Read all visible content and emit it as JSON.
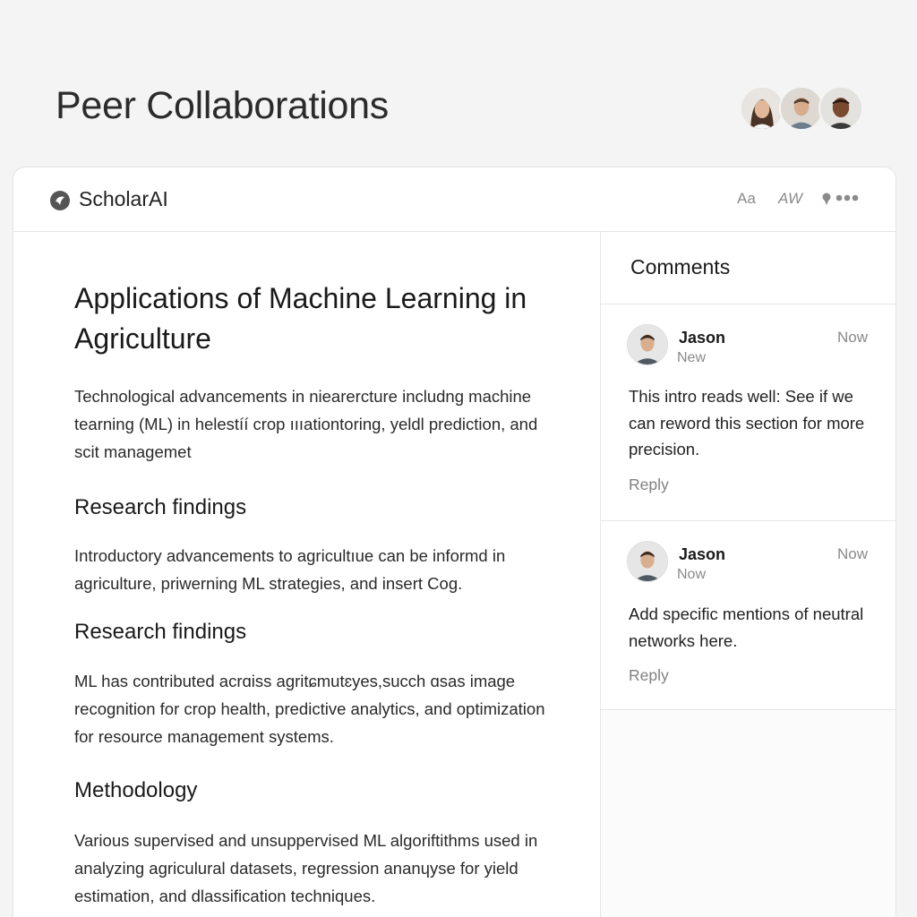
{
  "page": {
    "title": "Peer Collaborations"
  },
  "app": {
    "name": "ScholarAI",
    "tools": {
      "font": "Aa",
      "words": "AW",
      "more": "•••"
    }
  },
  "document": {
    "title": "Applications of Machine Learning in Agriculture",
    "intro": "Technological advancements in niearercture includng machine tearning (ML) in helestíí crop ıııationtoring, yeldl prediction, and scit managemet",
    "sections": [
      {
        "heading": "Research findings",
        "body": "Introductory advancements to agricultıue can be informd in agriculture, priwerning ML strategies, and insert Cog."
      },
      {
        "heading": "Research findings",
        "body": "ML has contributed acrɑiss agritɕmutɛyes,succh ɑsas image recognition for crop health, predictive analytics, and optimization for resource management systems."
      },
      {
        "heading": "Methodology",
        "body": "Various supervised and unsuppervised ML algoriftithms used in analyzing agriculural datasets, regression ananɥyse for yield estimation, and dlassification techniques."
      }
    ]
  },
  "comments": {
    "title": "Comments",
    "items": [
      {
        "author": "Jason",
        "status": "New",
        "time": "Now",
        "text": "This intro reads well: See if we can reword this section for more precision.",
        "reply": "Reply"
      },
      {
        "author": "Jason",
        "status": "Now",
        "time": "Now",
        "text": "Add specific mentions of neutral networks here.",
        "reply": "Reply"
      }
    ]
  },
  "colors": {
    "background": "#f4f4f4",
    "card": "#ffffff",
    "muted": "#8a8a8a",
    "border": "#e6e6e6"
  }
}
